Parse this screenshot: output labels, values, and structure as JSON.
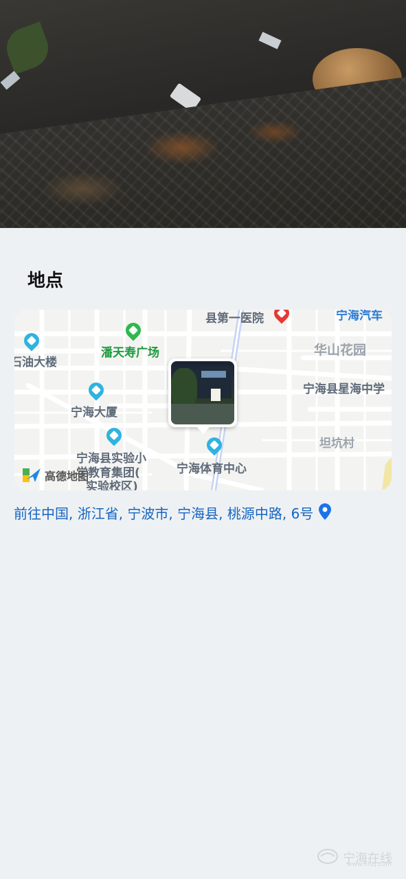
{
  "section": {
    "title": "地点"
  },
  "map": {
    "labels": {
      "hospital": "县第一医院",
      "auto": "宁海汽车",
      "plaza": "潘天寿广场",
      "huashan": "华山花园",
      "oil": "石油大楼",
      "xinghai": "宁海县星海中学",
      "dasha": "宁海大厦",
      "tankeng": "坦坑村",
      "school_1": "宁海县实验小",
      "school_2": "学教育集团(",
      "school_3": "实验校区)",
      "sports": "宁海体育中心"
    },
    "provider": "高德地图",
    "colors": {
      "poi_blue": "#2fb3e0",
      "poi_green": "#2fb84e",
      "poi_red": "#e53935"
    }
  },
  "address": {
    "text": "前往中国, 浙江省, 宁波市, 宁海县, 桃源中路, 6号",
    "icon": "location-pin-icon",
    "color": "#1565c0"
  },
  "watermark": {
    "text": "宁海在线",
    "sub": "www.nhzj.com"
  }
}
